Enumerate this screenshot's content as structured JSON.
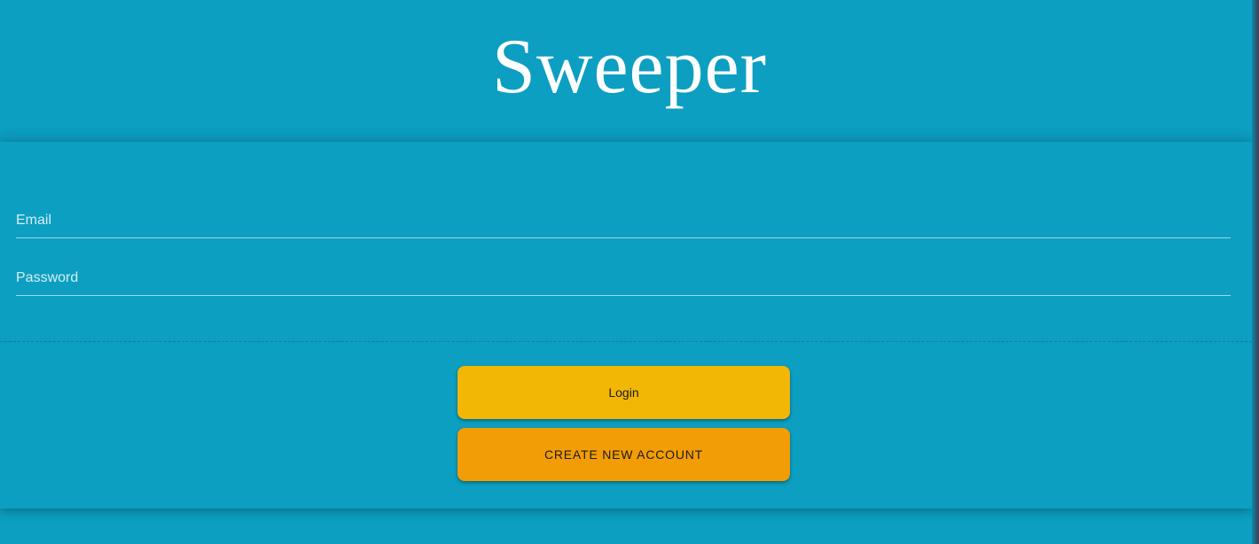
{
  "app": {
    "title": "Sweeper"
  },
  "form": {
    "email": {
      "placeholder": "Email",
      "value": ""
    },
    "password": {
      "placeholder": "Password",
      "value": ""
    }
  },
  "actions": {
    "login_label": "Login",
    "create_account_label": "CREATE NEW ACCOUNT"
  },
  "colors": {
    "background": "#0c9fc1",
    "login_button": "#f2b705",
    "create_button": "#f29d05",
    "title_text": "#ffffff"
  }
}
